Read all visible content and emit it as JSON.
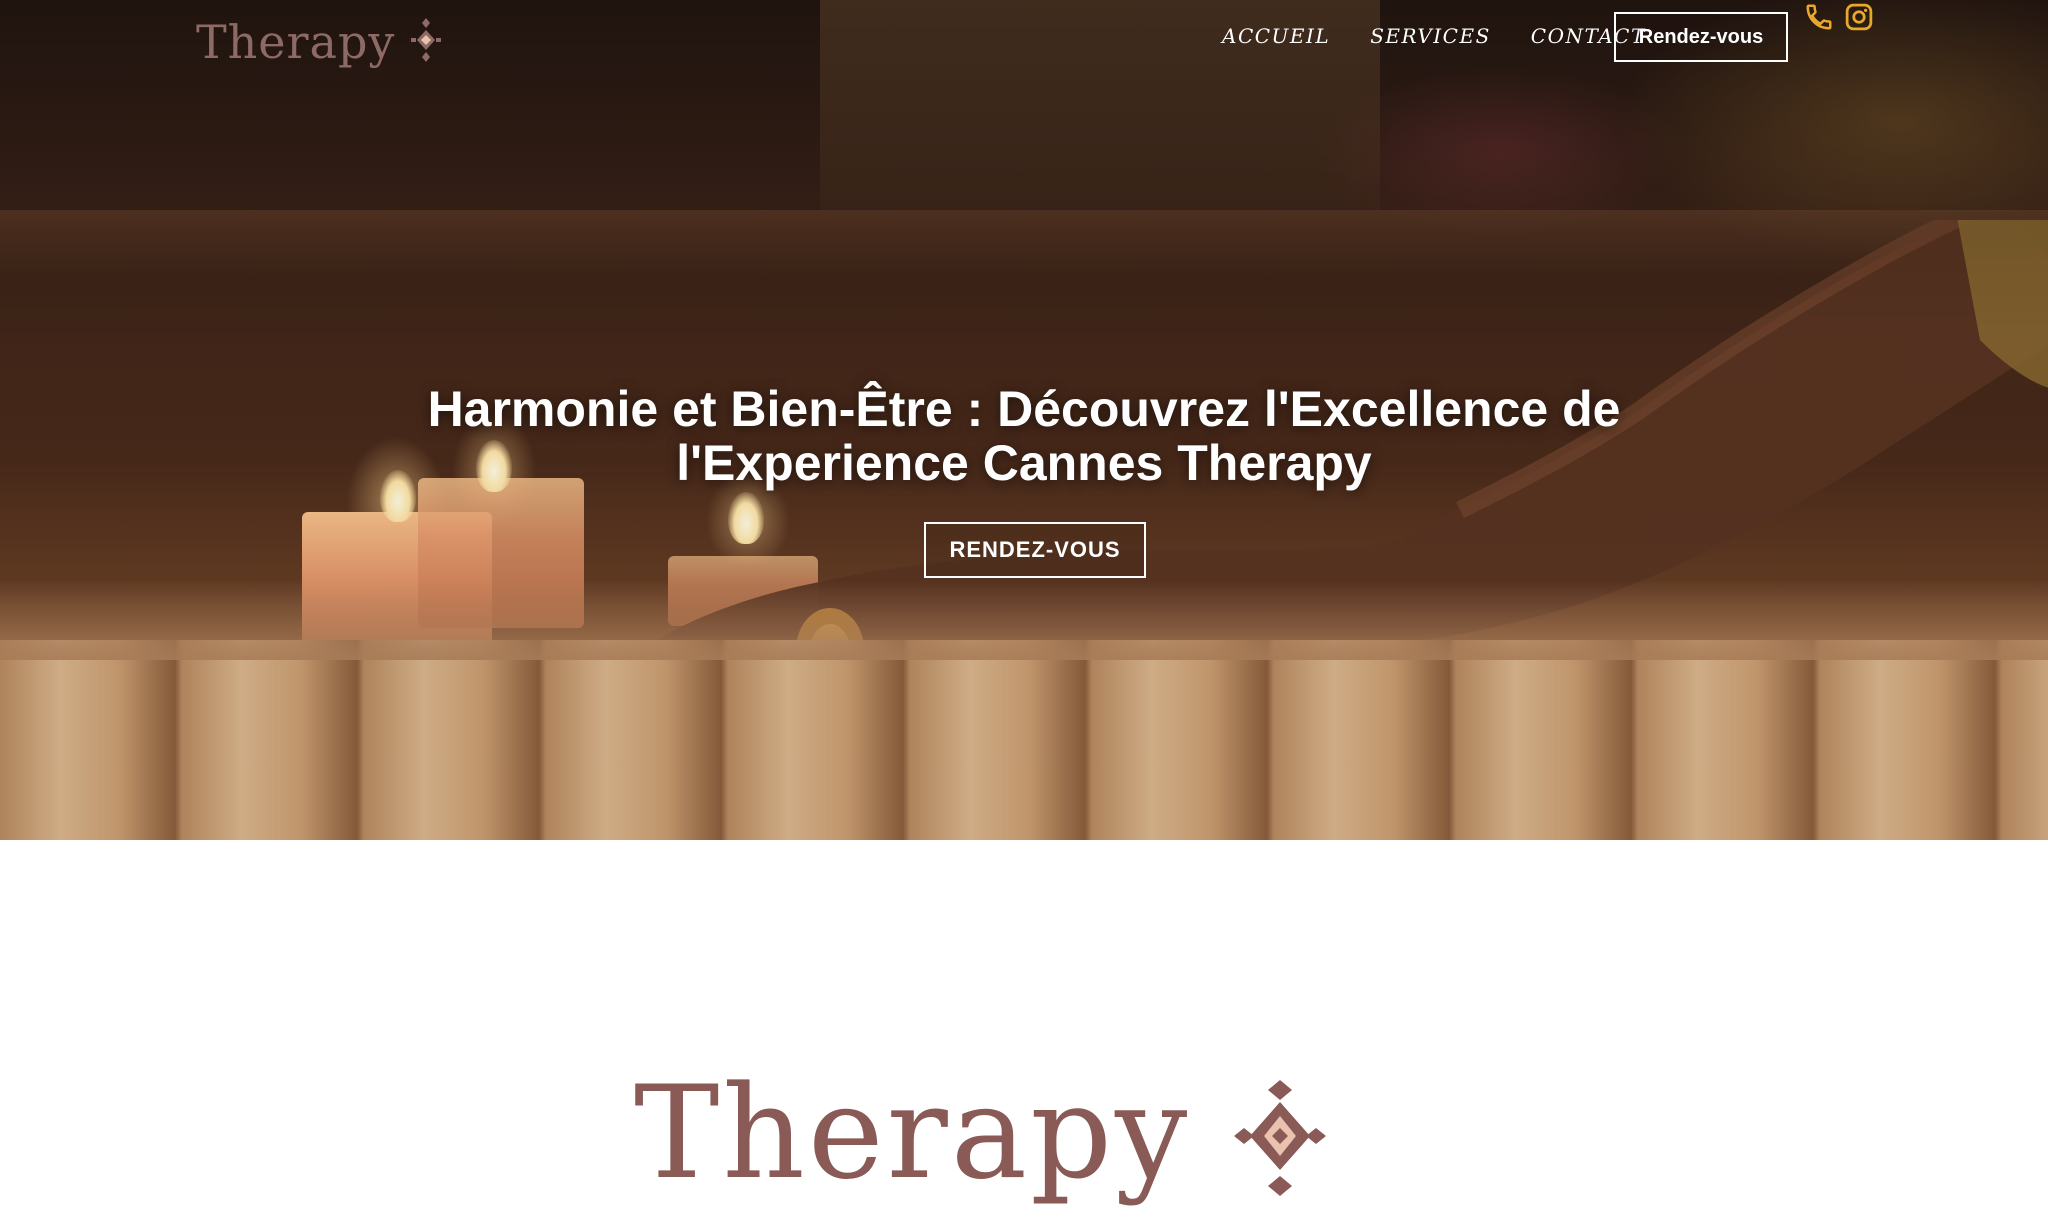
{
  "brand": {
    "logo_text": "Therapy",
    "logo_icon": "tribal-diamond-icon",
    "logo_color": "#8e6a66"
  },
  "nav": {
    "items": [
      {
        "label": "ACCUEIL"
      },
      {
        "label": "SERVICES"
      },
      {
        "label": "CONTACT"
      }
    ],
    "cta_label": "Rendez-vous",
    "social": [
      {
        "icon": "phone-icon"
      },
      {
        "icon": "instagram-icon"
      }
    ],
    "social_color": "#e8a92a"
  },
  "hero": {
    "title_line1": "Harmonie et Bien-Être : Découvrez l'Excellence de",
    "title_line2": "l'Experience Cannes Therapy",
    "button_label": "RENDEZ-VOUS"
  },
  "about": {
    "logo_text": "Therapy",
    "logo_icon": "tribal-diamond-icon",
    "logo_color": "#8a5a56",
    "accent_color": "#e9c3ae"
  }
}
